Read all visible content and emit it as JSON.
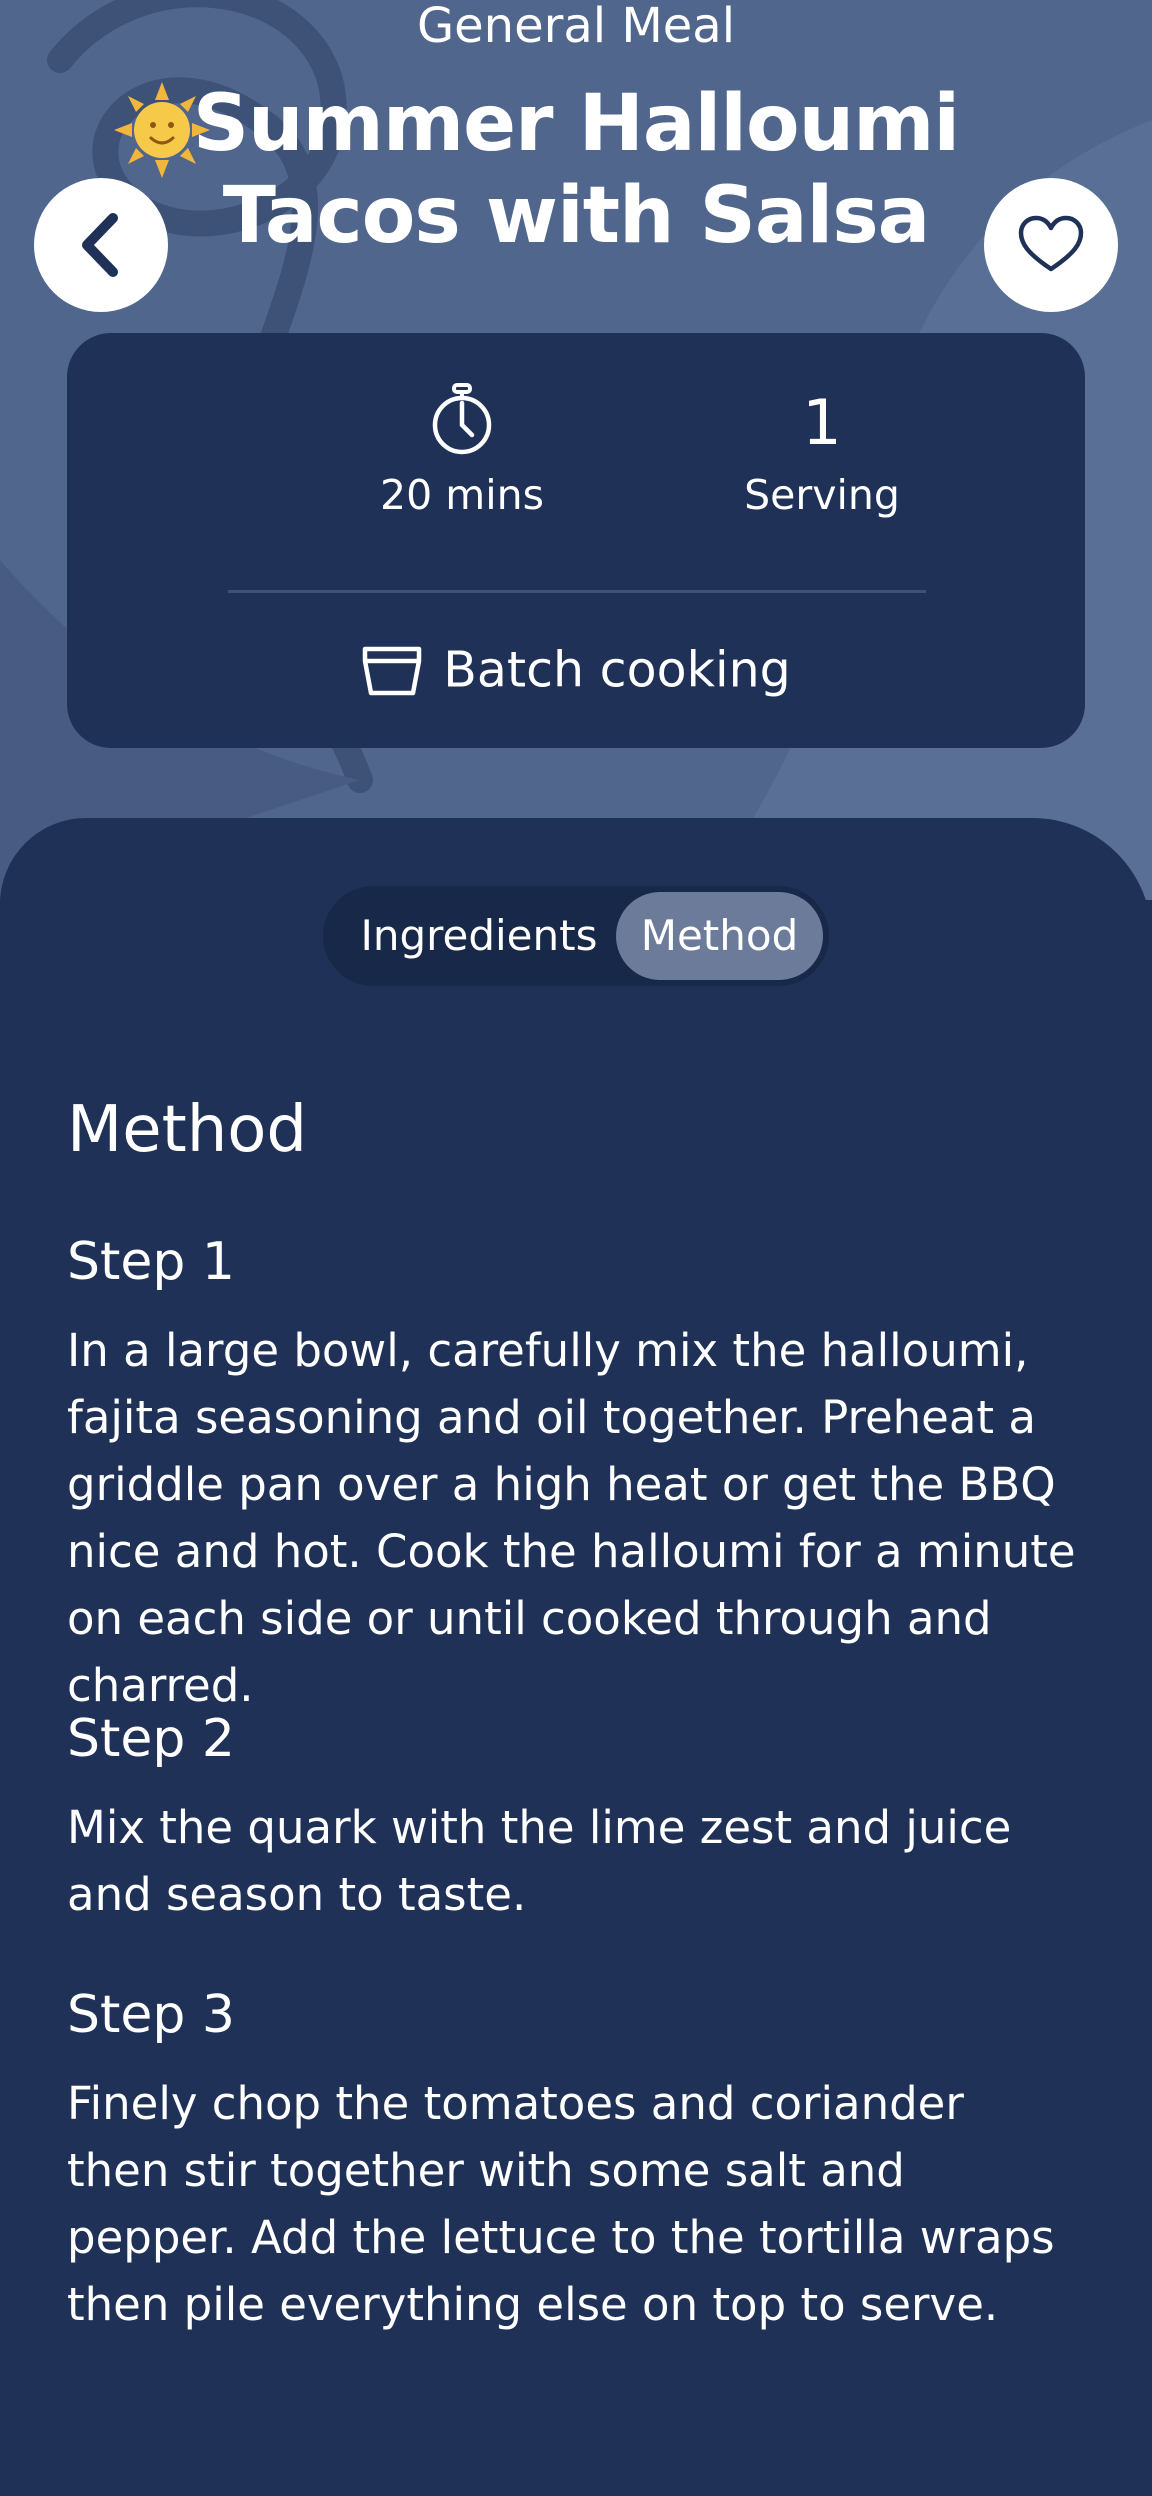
{
  "header": {
    "category": "General Meal",
    "title": "Summer Halloumi Tacos with Salsa",
    "title_emoji": "sun-with-face-icon"
  },
  "buttons": {
    "back_icon": "chevron-left-icon",
    "favorite_icon": "heart-icon"
  },
  "info": {
    "time_icon": "stopwatch-icon",
    "time_label": "20 mins",
    "servings_value": "1",
    "servings_label": "Serving",
    "tag_icon": "container-icon",
    "tag_label": "Batch cooking"
  },
  "tabs": {
    "items": [
      {
        "label": "Ingredients",
        "active": false
      },
      {
        "label": "Method",
        "active": true
      }
    ]
  },
  "method": {
    "heading": "Method",
    "steps": [
      {
        "title": "Step 1",
        "text": "In a large bowl, carefully mix the halloumi, fajita seasoning and oil together. Preheat a griddle pan over a high heat or get the BBQ nice and hot. Cook the halloumi for a minute on each side or until cooked through and charred."
      },
      {
        "title": "Step 2",
        "text": "Mix the quark with the lime zest and juice and season to taste."
      },
      {
        "title": "Step 3",
        "text": "Finely chop the tomatoes and coriander then stir together with some salt and pepper. Add the lettuce to the tortilla wraps then pile everything else on top to serve."
      }
    ]
  },
  "colors": {
    "hero_background": "#51668d",
    "sheet_background": "#1f3157",
    "segment_background": "#182848",
    "segment_active": "#6d7b9b",
    "text": "#ffffff"
  }
}
